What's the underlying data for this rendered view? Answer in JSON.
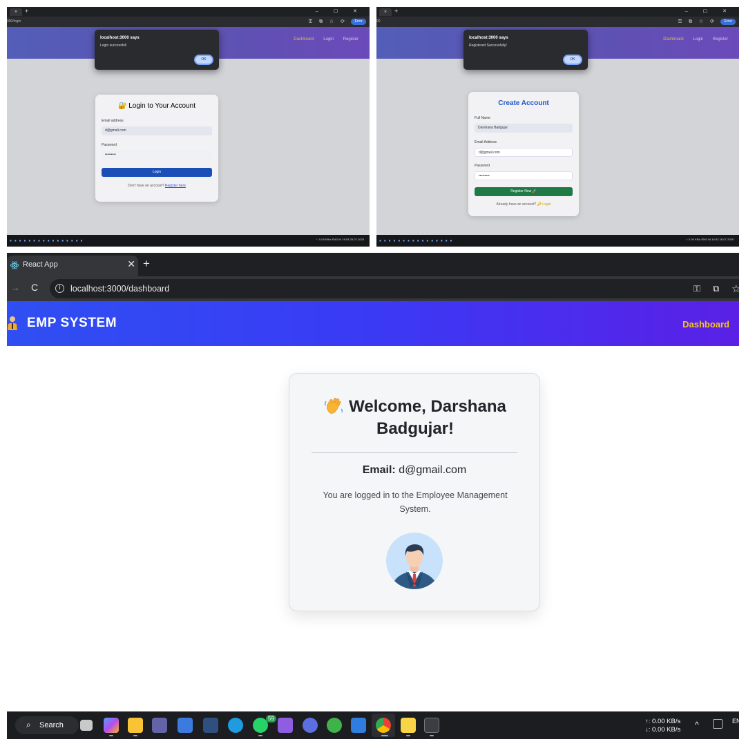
{
  "login_screenshot": {
    "tab_close": "×",
    "tab_plus": "+",
    "window_controls": "– ▢ ✕",
    "url": "000/login",
    "profile_button": "Error",
    "nav": [
      "Dashboard",
      "Login",
      "Register"
    ],
    "alert": {
      "title": "localhost:3000 says",
      "message": "Login successful!",
      "ok": "OK"
    },
    "card": {
      "title": "Login to Your Account",
      "email_label": "Email address",
      "email_value": "d@gmail.com",
      "password_label": "Password",
      "password_value": "•••••••••",
      "button": "Login",
      "footer_text": "Don't have an account?",
      "footer_link": "Register here"
    },
    "tray": {
      "net_up": "↑: 0.05 KB/s",
      "net_down": "↓: 0.06 KB/s",
      "lang": "ENG IN",
      "time": "16:53",
      "date": "28-07-2025"
    }
  },
  "register_screenshot": {
    "tab_close": "×",
    "tab_plus": "+",
    "window_controls": "– ▢ ✕",
    "url": "00",
    "profile_button": "Error",
    "nav": [
      "Dashboard",
      "Login",
      "Register"
    ],
    "alert": {
      "title": "localhost:3000 says",
      "message": "Registered Successfully!",
      "ok": "OK"
    },
    "card": {
      "title": "Create Account",
      "name_label": "Full Name",
      "name_value": "Darshana Badgujar",
      "email_label": "Email Address",
      "email_value": "d@gmail.com",
      "password_label": "Password",
      "password_value": "•••••••••",
      "button": "Register Now 🚀",
      "footer_text": "Already have an account?",
      "footer_link": "Login"
    },
    "tray": {
      "net_up": "↑: 0.00 KB/s",
      "net_down": "↓: 0.00 KB/s",
      "lang": "ENG IN",
      "time": "16:52",
      "date": "28-07-2025"
    }
  },
  "dashboard_screenshot": {
    "tab_title": "React App",
    "tab_close": "✕",
    "new_tab": "+",
    "forward": "→",
    "reload": "C",
    "url": "localhost:3000/dashboard",
    "brand": "EMP SYSTEM",
    "nav_link": "Dashboard",
    "welcome_line1": "Welcome, Darshana",
    "welcome_line2": "Badgujar!",
    "email_label": "Email:",
    "email_value": "d@gmail.com",
    "message": "You are logged in to the Employee Management System.",
    "taskbar": {
      "search": "Search",
      "whatsapp_badge": "59",
      "net_up": "↑: 0.00 KB/s",
      "net_down": "↓: 0.00 KB/s",
      "lang": "EN"
    },
    "colors": {
      "nav_gradient_start": "#2f4ff2",
      "nav_gradient_end": "#5a20e6",
      "nav_active": "#f7c515",
      "card_bg": "#f5f6f8"
    }
  }
}
